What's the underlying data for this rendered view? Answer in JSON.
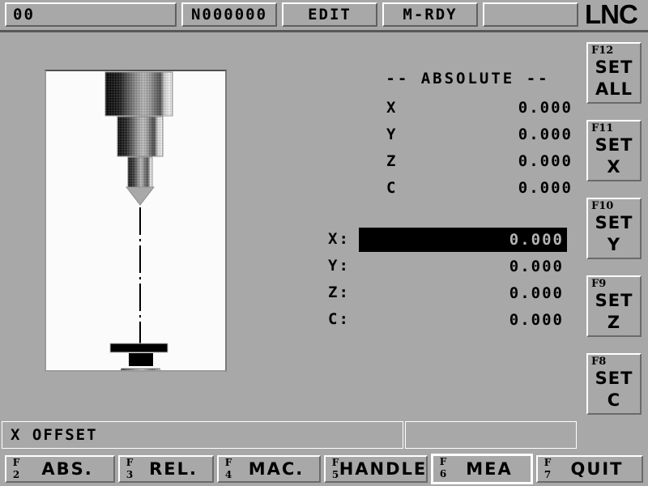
{
  "header": {
    "alarm_code": "00",
    "sequence": "N000000",
    "mode": "EDIT",
    "machine_status": "M-RDY",
    "spare": "",
    "brand": "LNC"
  },
  "absolute": {
    "title": "--  ABSOLUTE  --",
    "rows": [
      {
        "axis": "X",
        "value": "0.000"
      },
      {
        "axis": "Y",
        "value": "0.000"
      },
      {
        "axis": "Z",
        "value": "0.000"
      },
      {
        "axis": "C",
        "value": "0.000"
      }
    ]
  },
  "offset_entry": {
    "rows": [
      {
        "label": "X:",
        "value": "0.000",
        "selected": true
      },
      {
        "label": "Y:",
        "value": "0.000",
        "selected": false
      },
      {
        "label": "Z:",
        "value": "0.000",
        "selected": false
      },
      {
        "label": "C:",
        "value": "0.000",
        "selected": false
      }
    ]
  },
  "status_bar": {
    "left": "X OFFSET",
    "right": ""
  },
  "sidebar": {
    "keys": [
      {
        "fkey": "F12",
        "line1": "SET",
        "line2": "ALL"
      },
      {
        "fkey": "F11",
        "line1": "SET",
        "line2": "X"
      },
      {
        "fkey": "F10",
        "line1": "SET",
        "line2": "Y"
      },
      {
        "fkey": "F9",
        "line1": "SET",
        "line2": "Z"
      },
      {
        "fkey": "F8",
        "line1": "SET",
        "line2": "C"
      }
    ]
  },
  "bottom_bar": {
    "keys": [
      {
        "f": "F",
        "n": "2",
        "label": "ABS.",
        "active": false
      },
      {
        "f": "F",
        "n": "3",
        "label": "REL.",
        "active": false
      },
      {
        "f": "F",
        "n": "4",
        "label": "MAC.",
        "active": false
      },
      {
        "f": "F",
        "n": "5",
        "label": "HANDLE",
        "active": false
      },
      {
        "f": "F",
        "n": "6",
        "label": "MEA",
        "active": true
      },
      {
        "f": "F",
        "n": "7",
        "label": "QUIT",
        "active": false
      }
    ]
  },
  "graphic": {
    "name": "tool-and-workpiece-diagram",
    "description": "CNC spindle tool above workpiece with dash-dot centerline",
    "colors": {
      "panel_background": "#fbfbfb",
      "outline": "#000000",
      "screen_background": "#a8a8a8",
      "selected_field_background": "#000000",
      "selected_field_text": "#b4b4b4"
    }
  }
}
